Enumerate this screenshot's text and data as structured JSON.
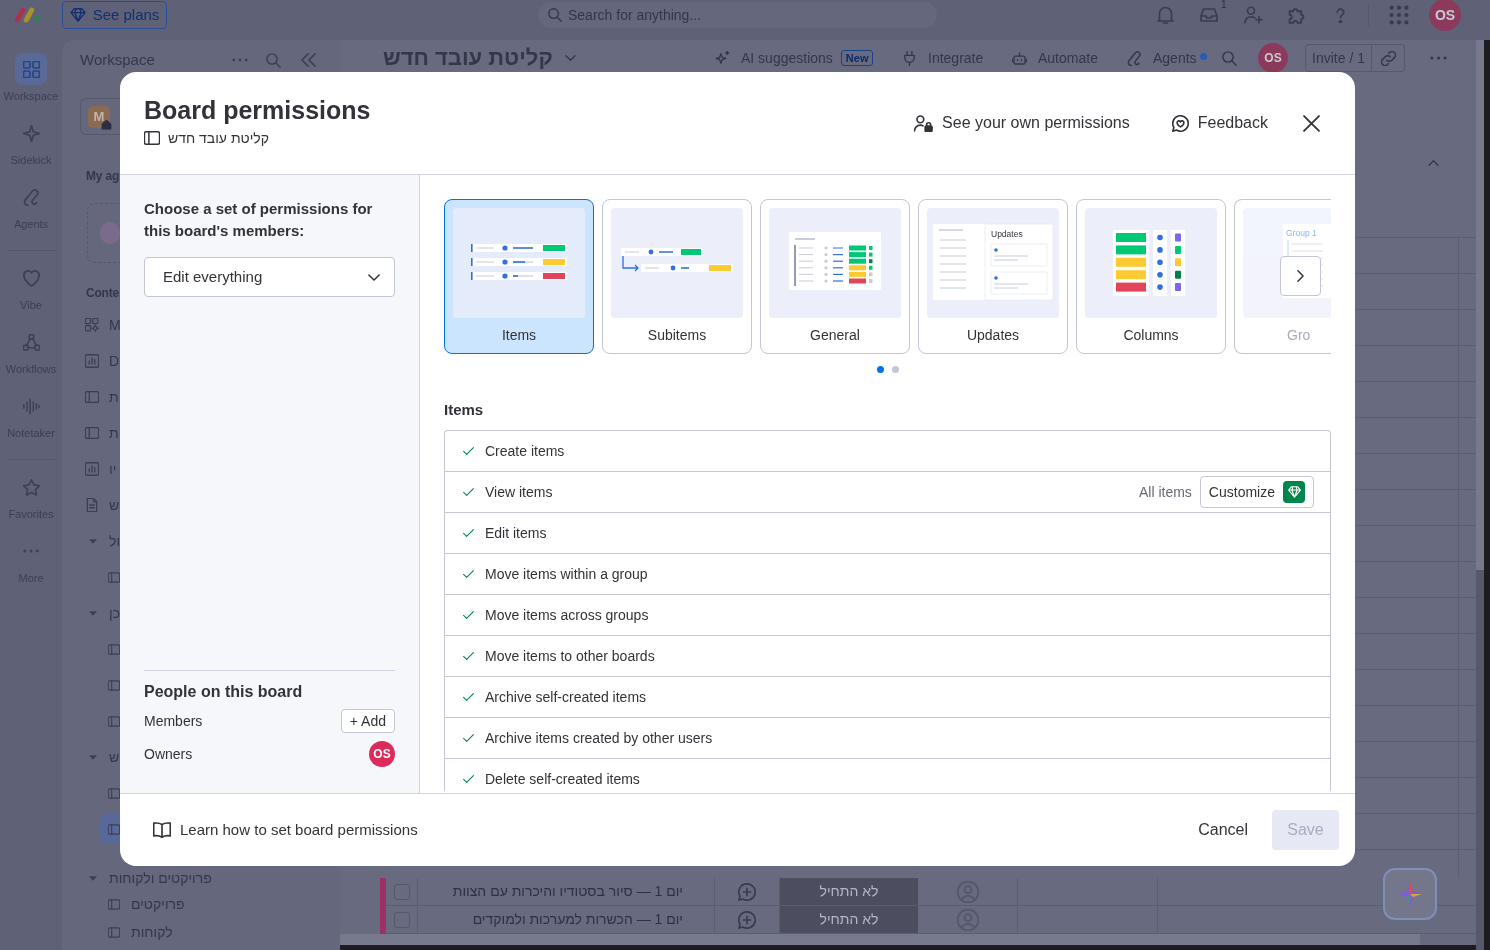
{
  "top_bar": {
    "plans_button": "See plans",
    "search": {
      "placeholder": "Search for anything..."
    },
    "inbox_count": "1",
    "avatar": "OS"
  },
  "left_rail": [
    {
      "label": "Workspace",
      "selected": true
    },
    {
      "label": "Sidekick",
      "selected": false
    },
    {
      "label": "Agents",
      "selected": false
    },
    {
      "label": "Vibe",
      "selected": false
    },
    {
      "label": "Workflows",
      "selected": false
    },
    {
      "label": "Notetaker",
      "selected": false
    },
    {
      "label": "Favorites",
      "selected": false
    },
    {
      "label": "More",
      "selected": false
    }
  ],
  "workspace_panel": {
    "title": "Workspace",
    "workspace_initial": "M",
    "agents_heading": "My ag",
    "content_heading": "Conte",
    "items": [
      {
        "kind": "apps",
        "label": "M"
      },
      {
        "kind": "dashboard",
        "label": "D"
      },
      {
        "kind": "board",
        "label": "ת"
      },
      {
        "kind": "board",
        "label": "ת"
      },
      {
        "kind": "dashboard",
        "label": "יו"
      },
      {
        "kind": "doc",
        "label": "ש"
      },
      {
        "kind": "folder",
        "label": "ול",
        "expanded": true,
        "children": [
          {
            "kind": "board",
            "selected": false
          }
        ]
      },
      {
        "kind": "folder",
        "label": "כן",
        "expanded": true,
        "children": [
          {
            "kind": "board",
            "selected": false
          },
          {
            "kind": "board",
            "selected": false
          },
          {
            "kind": "board",
            "selected": false
          }
        ]
      },
      {
        "kind": "folder",
        "label": "ש",
        "expanded": true,
        "children": [
          {
            "kind": "board",
            "selected": false
          },
          {
            "kind": "board",
            "selected": true
          }
        ]
      },
      {
        "kind": "folder",
        "label": "פרויקטים ולקוחות",
        "expanded": true,
        "children": [
          {
            "kind": "board",
            "label": "פרויקטים",
            "selected": false
          },
          {
            "kind": "board",
            "label": "לקוחות",
            "selected": false
          }
        ]
      }
    ]
  },
  "board": {
    "title": "קליטת עובד חדש",
    "toolbar": [
      {
        "kind": "ai",
        "label": "AI suggestions",
        "badge": "New"
      },
      {
        "kind": "integrate",
        "label": "Integrate"
      },
      {
        "kind": "automate",
        "label": "Automate"
      },
      {
        "kind": "agents",
        "label": "Agents",
        "dot": true
      }
    ],
    "avatar": "OS",
    "invite": "Invite / 1",
    "rows": [
      {
        "title": "יום 1 — סיור בסטודיו והיכרות עם הצוות",
        "status": "לא התחיל",
        "checked": false
      },
      {
        "title": "יום 1 — הכשרות למערכות ולמוקדים",
        "status": "לא התחיל",
        "checked": false
      }
    ]
  },
  "modal": {
    "title": "Board permissions",
    "board_name": "קליטת עובד חדש",
    "links": [
      {
        "kind": "permissions",
        "label": "See your own permissions"
      },
      {
        "kind": "feedback",
        "label": "Feedback"
      }
    ],
    "prompt": "Choose a set of permissions for this board's members:",
    "preset": {
      "value": "Edit everything"
    },
    "people": {
      "title": "People on this board",
      "members": {
        "label": "Members",
        "action": "+ Add"
      },
      "owners": {
        "label": "Owners",
        "avatar": "OS"
      }
    },
    "categories": [
      {
        "kind": "items",
        "label": "Items",
        "selected": true
      },
      {
        "kind": "subitems",
        "label": "Subitems",
        "selected": false
      },
      {
        "kind": "general",
        "label": "General",
        "selected": false
      },
      {
        "kind": "updates",
        "label": "Updates",
        "caption": "Updates",
        "selected": false
      },
      {
        "kind": "columns",
        "label": "Columns",
        "selected": false
      },
      {
        "kind": "groups",
        "label": "Gro",
        "caption": "Group 1",
        "selected": false
      }
    ],
    "pages": [
      {
        "selected": true
      },
      {
        "selected": false
      }
    ],
    "section_title": "Items",
    "permissions": [
      {
        "label": "Create items",
        "checked": true
      },
      {
        "label": "View items",
        "checked": true,
        "scope": "All items",
        "action": "Customize"
      },
      {
        "label": "Edit items",
        "checked": true
      },
      {
        "label": "Move items within a group",
        "checked": true
      },
      {
        "label": "Move items across groups",
        "checked": true
      },
      {
        "label": "Move items to other boards",
        "checked": true
      },
      {
        "label": "Archive self-created items",
        "checked": true
      },
      {
        "label": "Archive items created by other users",
        "checked": true
      },
      {
        "label": "Delete self-created items",
        "checked": true
      }
    ],
    "help_link": "Learn how to set board permissions",
    "cancel": "Cancel",
    "save": {
      "label": "Save",
      "disabled": true
    }
  }
}
